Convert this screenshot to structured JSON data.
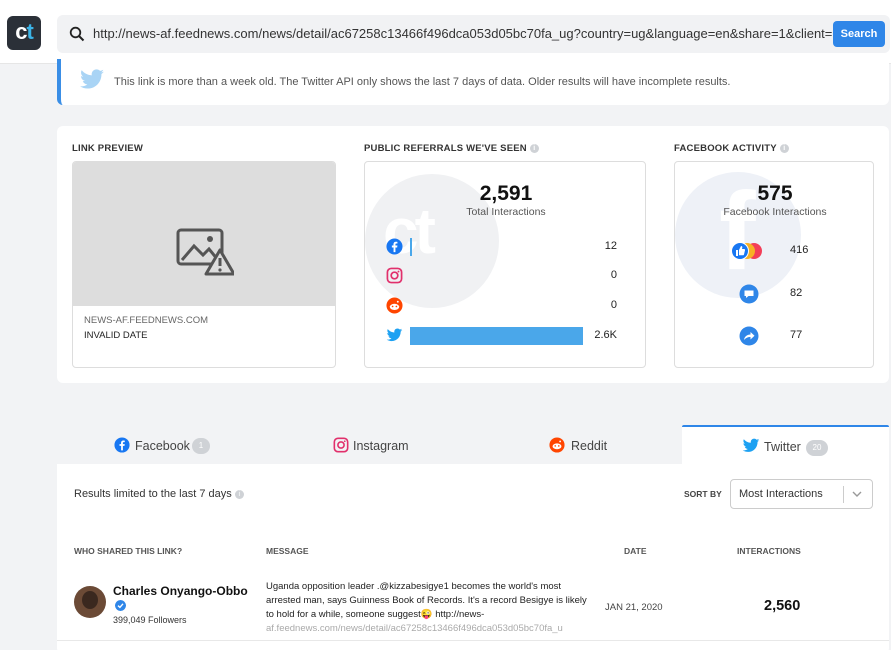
{
  "header": {
    "logo_c": "c",
    "logo_t": "t",
    "url": "http://news-af.feednews.com/news/detail/ac67258c13466f496dca053d05bc70fa_ug?country=ug&language=en&share=1&client=",
    "search_label": "Search"
  },
  "warning": {
    "text": "This link is more than a week old. The Twitter API only shows the last 7 days of data. Older results will have incomplete results."
  },
  "link_preview": {
    "title": "LINK PREVIEW",
    "domain": "NEWS-AF.FEEDNEWS.COM",
    "date": "INVALID DATE"
  },
  "referrals": {
    "title": "PUBLIC REFERRALS WE'VE SEEN",
    "total": "2,591",
    "total_label": "Total Interactions",
    "rows": [
      {
        "platform": "facebook",
        "icon": "facebook-icon",
        "value": "12",
        "share": 0.005
      },
      {
        "platform": "instagram",
        "icon": "instagram-icon",
        "value": "0",
        "share": 0
      },
      {
        "platform": "reddit",
        "icon": "reddit-icon",
        "value": "0",
        "share": 0
      },
      {
        "platform": "twitter",
        "icon": "twitter-icon",
        "value": "2.6K",
        "share": 1
      }
    ]
  },
  "facebook_activity": {
    "title": "FACEBOOK ACTIVITY",
    "total": "575",
    "total_label": "Facebook Interactions",
    "rows": [
      {
        "type": "reactions",
        "icon": "reactions-icon",
        "value": "416"
      },
      {
        "type": "comments",
        "icon": "comment-icon",
        "value": "82"
      },
      {
        "type": "shares",
        "icon": "share-icon",
        "value": "77"
      }
    ]
  },
  "tabs": [
    {
      "label": "Facebook",
      "badge": "1",
      "icon": "facebook-icon",
      "active": false
    },
    {
      "label": "Instagram",
      "badge": "",
      "icon": "instagram-icon",
      "active": false
    },
    {
      "label": "Reddit",
      "badge": "",
      "icon": "reddit-icon",
      "active": false
    },
    {
      "label": "Twitter",
      "badge": "20",
      "icon": "twitter-icon",
      "active": true
    }
  ],
  "results": {
    "note": "Results limited to the last 7 days",
    "sort_label": "SORT BY",
    "sort_value": "Most Interactions",
    "columns": [
      "WHO SHARED THIS LINK?",
      "MESSAGE",
      "DATE",
      "INTERACTIONS"
    ],
    "rows": [
      {
        "name": "Charles Onyango-Obbo",
        "followers": "399,049 Followers",
        "message": "Uganda opposition leader .@kizzabesigye1 becomes the world's most arrested man, says Guinness Book of Records. It's a record Besigye is likely to hold for a while, someone suggest😜 http://news-",
        "message_faded": "af.feednews.com/news/detail/ac67258c13466f496dca053d05bc70fa_u",
        "date": "JAN 21, 2020",
        "interactions": "2,560"
      }
    ]
  },
  "colors": {
    "accent": "#2f86e8",
    "twitter": "#1da1f2",
    "facebook": "#1877f2",
    "reddit": "#ff4500",
    "instagram": "#e1306c"
  }
}
